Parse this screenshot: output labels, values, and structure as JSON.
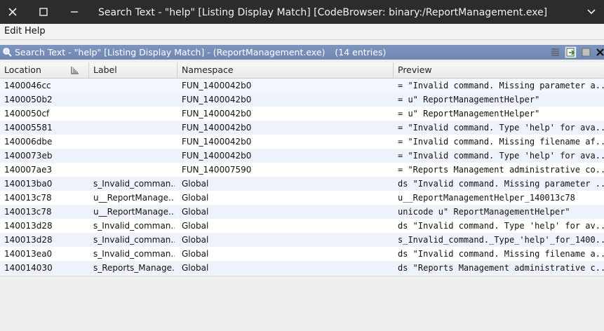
{
  "window": {
    "title": "Search Text - \"help\"  [Listing Display Match] [CodeBrowser: binary:/ReportManagement.exe]"
  },
  "menu": {
    "edit": "Edit",
    "help": "Help"
  },
  "panel": {
    "title": "Search Text - \"help\"  [Listing Display Match] - (ReportManagement.exe)",
    "count": "(14 entries)"
  },
  "columns": {
    "location": "Location",
    "label": "Label",
    "namespace": "Namespace",
    "preview": "Preview"
  },
  "rows": [
    {
      "location": "1400046cc",
      "label": "",
      "namespace": "FUN_1400042b0",
      "preview": "= \"Invalid command. Missing parameter a..."
    },
    {
      "location": "1400050b2",
      "label": "",
      "namespace": "FUN_1400042b0",
      "preview": "= u\" ReportManagementHelper\""
    },
    {
      "location": "1400050cf",
      "label": "",
      "namespace": "FUN_1400042b0",
      "preview": "= u\" ReportManagementHelper\""
    },
    {
      "location": "140005581",
      "label": "",
      "namespace": "FUN_1400042b0",
      "preview": "= \"Invalid command. Type 'help' for ava..."
    },
    {
      "location": "140006dbe",
      "label": "",
      "namespace": "FUN_1400042b0",
      "preview": "= \"Invalid command. Missing filename af..."
    },
    {
      "location": "1400073eb",
      "label": "",
      "namespace": "FUN_1400042b0",
      "preview": "= \"Invalid command. Type 'help' for ava..."
    },
    {
      "location": "140007ae3",
      "label": "",
      "namespace": "FUN_140007590",
      "preview": "= \"Reports Management administrative co..."
    },
    {
      "location": "140013ba0",
      "label": "s_Invalid_comman...",
      "namespace": "Global",
      "preview": "ds \"Invalid command. Missing parameter ..."
    },
    {
      "location": "140013c78",
      "label": "u__ReportManage...",
      "namespace": "Global",
      "preview": "u__ReportManagementHelper_140013c78"
    },
    {
      "location": "140013c78",
      "label": "u__ReportManage...",
      "namespace": "Global",
      "preview": "unicode u\" ReportManagementHelper\""
    },
    {
      "location": "140013d28",
      "label": "s_Invalid_comman...",
      "namespace": "Global",
      "preview": "ds \"Invalid command. Type 'help' for av..."
    },
    {
      "location": "140013d28",
      "label": "s_Invalid_comman...",
      "namespace": "Global",
      "preview": "s_Invalid_command._Type_'help'_for_1400..."
    },
    {
      "location": "140013ea0",
      "label": "s_Invalid_comman...",
      "namespace": "Global",
      "preview": "ds \"Invalid command. Missing filename a..."
    },
    {
      "location": "140014030",
      "label": "s_Reports_Manage...",
      "namespace": "Global",
      "preview": "ds \"Reports Management administrative c..."
    }
  ]
}
